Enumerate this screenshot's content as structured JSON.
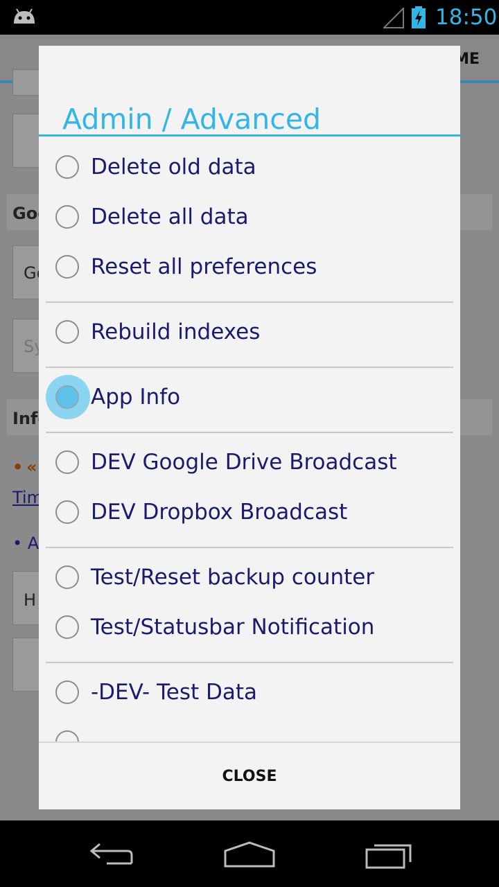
{
  "status_bar": {
    "time": "18:50",
    "icons": [
      "android-icon",
      "signal-icon",
      "battery-charging-icon"
    ]
  },
  "background_app": {
    "action_bar_text": "ME",
    "visible_fragments": [
      "Goo",
      "Go",
      "Sy",
      "Info",
      "•",
      "«",
      "Tim",
      "• A",
      "H"
    ]
  },
  "dialog": {
    "title": "Admin / Advanced",
    "items": [
      {
        "label": "Delete old data",
        "selected": false
      },
      {
        "label": "Delete all data",
        "selected": false
      },
      {
        "label": "Reset all preferences",
        "selected": false
      },
      {
        "label": "Rebuild indexes",
        "selected": false
      },
      {
        "label": "App Info",
        "selected": true
      },
      {
        "label": "DEV Google Drive Broadcast",
        "selected": false
      },
      {
        "label": "DEV Dropbox Broadcast",
        "selected": false
      },
      {
        "label": "Test/Reset backup counter",
        "selected": false
      },
      {
        "label": "Test/Statusbar Notification",
        "selected": false
      },
      {
        "label": "-DEV- Test Data",
        "selected": false
      }
    ],
    "close_label": "CLOSE"
  },
  "nav_bar": {
    "icons": [
      "back-icon",
      "home-icon",
      "recent-apps-icon"
    ]
  },
  "colors": {
    "accent": "#33b5e5",
    "item_text": "#1a1a6e",
    "dialog_bg": "#f3f3f3"
  }
}
